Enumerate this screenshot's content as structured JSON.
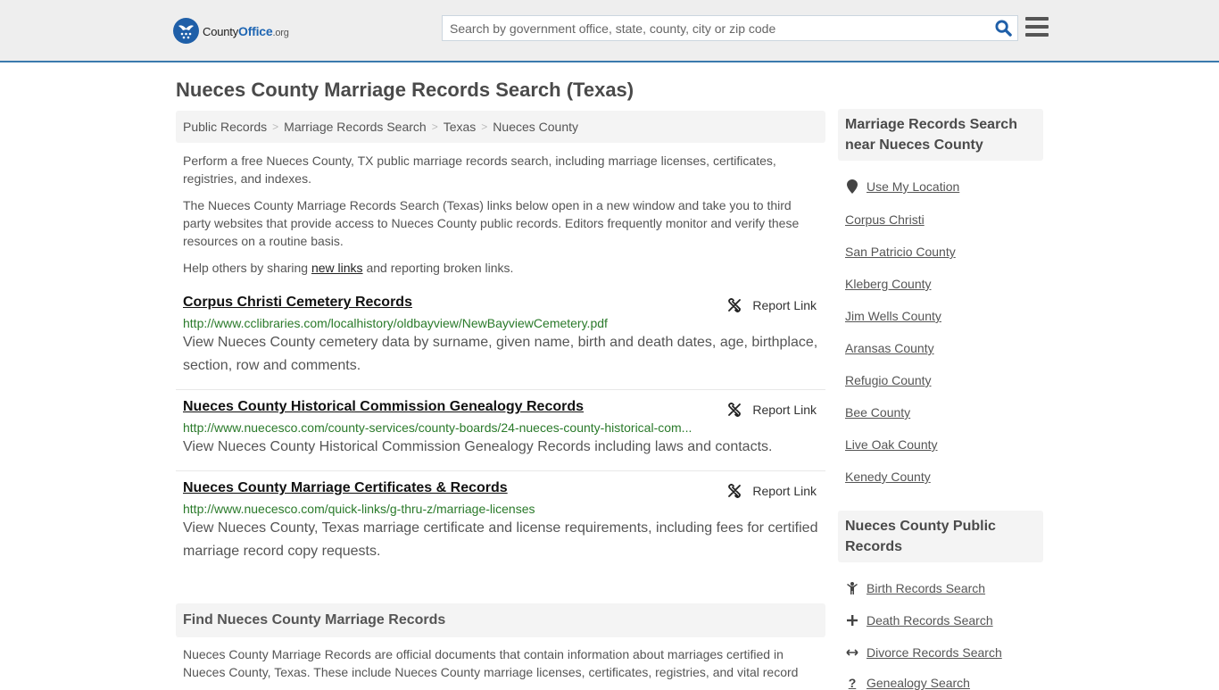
{
  "header": {
    "logo": {
      "name": "County",
      "bold": "Office",
      "tld": ".org"
    },
    "search_placeholder": "Search by government office, state, county, city or zip code",
    "accent_color": "#3a7aad"
  },
  "page_title": "Nueces County Marriage Records Search (Texas)",
  "breadcrumb": [
    "Public Records",
    "Marriage Records Search",
    "Texas",
    "Nueces County"
  ],
  "breadcrumb_separator": ">",
  "intro": {
    "p1": "Perform a free Nueces County, TX public marriage records search, including marriage licenses, certificates, registries, and indexes.",
    "p2": "The Nueces County Marriage Records Search (Texas) links below open in a new window and take you to third party websites that provide access to Nueces County public records. Editors frequently monitor and verify these resources on a routine basis.",
    "p3_before": "Help others by sharing ",
    "p3_link": "new links",
    "p3_after": " and reporting broken links."
  },
  "results": [
    {
      "title": "Corpus Christi Cemetery Records",
      "url": "http://www.cclibraries.com/localhistory/oldbayview/NewBayviewCemetery.pdf",
      "description": "View Nueces County cemetery data by surname, given name, birth and death dates, age, birthplace, section, row and comments.",
      "report_label": "Report Link"
    },
    {
      "title": "Nueces County Historical Commission Genealogy Records",
      "url": "http://www.nuecesco.com/county-services/county-boards/24-nueces-county-historical-com...",
      "description": "View Nueces County Historical Commission Genealogy Records including laws and contacts.",
      "report_label": "Report Link"
    },
    {
      "title": "Nueces County Marriage Certificates & Records",
      "url": "http://www.nuecesco.com/quick-links/g-thru-z/marriage-licenses",
      "description": "View Nueces County, Texas marriage certificate and license requirements, including fees for certified marriage record copy requests.",
      "report_label": "Report Link"
    }
  ],
  "find_section": {
    "title": "Find Nueces County Marriage Records",
    "body": "Nueces County Marriage Records are official documents that contain information about marriages certified in Nueces County, Texas. These include Nueces County marriage licenses, certificates, registries, and vital record"
  },
  "sidebar": {
    "nearby": {
      "title": "Marriage Records Search near Nueces County",
      "use_location": "Use My Location",
      "links": [
        "Corpus Christi",
        "San Patricio County",
        "Kleberg County",
        "Jim Wells County",
        "Aransas County",
        "Refugio County",
        "Bee County",
        "Live Oak County",
        "Kenedy County"
      ]
    },
    "public_records": {
      "title": "Nueces County Public Records",
      "links": [
        {
          "label": "Birth Records Search",
          "icon": "child-icon"
        },
        {
          "label": "Death Records Search",
          "icon": "cross-icon"
        },
        {
          "label": "Divorce Records Search",
          "icon": "arrows-horizontal-icon"
        },
        {
          "label": "Genealogy Search",
          "icon": "question-icon"
        }
      ]
    }
  }
}
